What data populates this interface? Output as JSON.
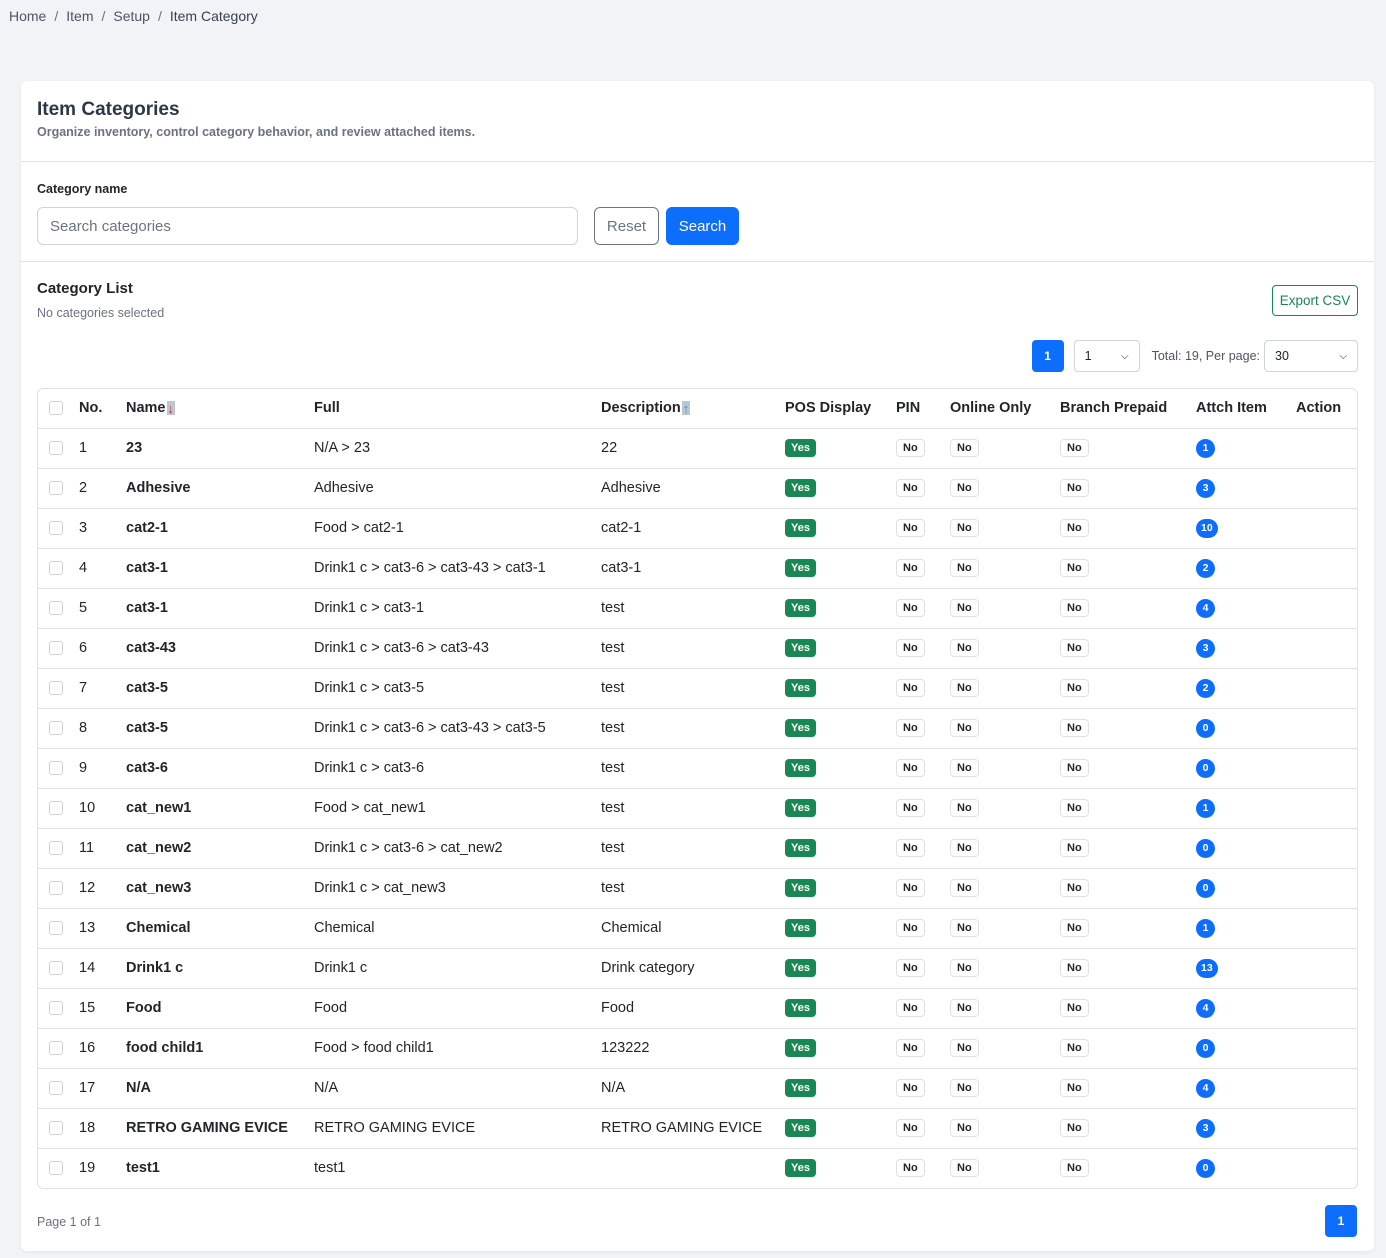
{
  "breadcrumb": [
    "Home",
    "Item",
    "Setup",
    "Item Category"
  ],
  "header": {
    "title": "Item Categories",
    "subtitle": "Organize inventory, control category behavior, and review attached items."
  },
  "filter": {
    "label": "Category name",
    "placeholder": "Search categories",
    "reset_label": "Reset",
    "search_label": "Search"
  },
  "list": {
    "title": "Category List",
    "selection_status": "No categories selected",
    "export_label": "Export CSV",
    "current_page": "1",
    "page_select_value": "1",
    "total_text": "Total: 19, Per page:",
    "per_page_value": "30"
  },
  "table": {
    "columns": [
      "No.",
      "Name",
      "Full",
      "Description",
      "POS Display",
      "PIN",
      "Online Only",
      "Branch Prepaid",
      "Attch Item",
      "Action"
    ],
    "rows": [
      {
        "no": "1",
        "name": "23",
        "full": "N/A > 23",
        "description": "22",
        "pos": "Yes",
        "pin": "No",
        "online": "No",
        "prepaid": "No",
        "items": "1"
      },
      {
        "no": "2",
        "name": "Adhesive",
        "full": "Adhesive",
        "description": "Adhesive",
        "pos": "Yes",
        "pin": "No",
        "online": "No",
        "prepaid": "No",
        "items": "3"
      },
      {
        "no": "3",
        "name": "cat2-1",
        "full": "Food > cat2-1",
        "description": "cat2-1",
        "pos": "Yes",
        "pin": "No",
        "online": "No",
        "prepaid": "No",
        "items": "10"
      },
      {
        "no": "4",
        "name": "cat3-1",
        "full": "Drink1 c > cat3-6 > cat3-43 > cat3-1",
        "description": "cat3-1",
        "pos": "Yes",
        "pin": "No",
        "online": "No",
        "prepaid": "No",
        "items": "2"
      },
      {
        "no": "5",
        "name": "cat3-1",
        "full": "Drink1 c > cat3-1",
        "description": "test",
        "pos": "Yes",
        "pin": "No",
        "online": "No",
        "prepaid": "No",
        "items": "4"
      },
      {
        "no": "6",
        "name": "cat3-43",
        "full": "Drink1 c > cat3-6 > cat3-43",
        "description": "test",
        "pos": "Yes",
        "pin": "No",
        "online": "No",
        "prepaid": "No",
        "items": "3"
      },
      {
        "no": "7",
        "name": "cat3-5",
        "full": "Drink1 c > cat3-5",
        "description": "test",
        "pos": "Yes",
        "pin": "No",
        "online": "No",
        "prepaid": "No",
        "items": "2"
      },
      {
        "no": "8",
        "name": "cat3-5",
        "full": "Drink1 c > cat3-6 > cat3-43 > cat3-5",
        "description": "test",
        "pos": "Yes",
        "pin": "No",
        "online": "No",
        "prepaid": "No",
        "items": "0"
      },
      {
        "no": "9",
        "name": "cat3-6",
        "full": "Drink1 c > cat3-6",
        "description": "test",
        "pos": "Yes",
        "pin": "No",
        "online": "No",
        "prepaid": "No",
        "items": "0"
      },
      {
        "no": "10",
        "name": "cat_new1",
        "full": "Food > cat_new1",
        "description": "test",
        "pos": "Yes",
        "pin": "No",
        "online": "No",
        "prepaid": "No",
        "items": "1"
      },
      {
        "no": "11",
        "name": "cat_new2",
        "full": "Drink1 c > cat3-6 > cat_new2",
        "description": "test",
        "pos": "Yes",
        "pin": "No",
        "online": "No",
        "prepaid": "No",
        "items": "0"
      },
      {
        "no": "12",
        "name": "cat_new3",
        "full": "Drink1 c > cat_new3",
        "description": "test",
        "pos": "Yes",
        "pin": "No",
        "online": "No",
        "prepaid": "No",
        "items": "0"
      },
      {
        "no": "13",
        "name": "Chemical",
        "full": "Chemical",
        "description": "Chemical",
        "pos": "Yes",
        "pin": "No",
        "online": "No",
        "prepaid": "No",
        "items": "1"
      },
      {
        "no": "14",
        "name": "Drink1 c",
        "full": "Drink1 c",
        "description": "Drink category",
        "pos": "Yes",
        "pin": "No",
        "online": "No",
        "prepaid": "No",
        "items": "13"
      },
      {
        "no": "15",
        "name": "Food",
        "full": "Food",
        "description": "Food",
        "pos": "Yes",
        "pin": "No",
        "online": "No",
        "prepaid": "No",
        "items": "4"
      },
      {
        "no": "16",
        "name": "food child1",
        "full": "Food > food child1",
        "description": "123222",
        "pos": "Yes",
        "pin": "No",
        "online": "No",
        "prepaid": "No",
        "items": "0"
      },
      {
        "no": "17",
        "name": "N/A",
        "full": "N/A",
        "description": "N/A",
        "pos": "Yes",
        "pin": "No",
        "online": "No",
        "prepaid": "No",
        "items": "4"
      },
      {
        "no": "18",
        "name": "RETRO GAMING EVICE",
        "full": "RETRO GAMING EVICE",
        "description": "RETRO GAMING EVICE",
        "pos": "Yes",
        "pin": "No",
        "online": "No",
        "prepaid": "No",
        "items": "3"
      },
      {
        "no": "19",
        "name": "test1",
        "full": "test1",
        "description": "",
        "pos": "Yes",
        "pin": "No",
        "online": "No",
        "prepaid": "No",
        "items": "0"
      }
    ]
  },
  "footer": {
    "page_info": "Page 1 of 1",
    "current_page": "1"
  },
  "colors": {
    "primary": "#0d6efd",
    "success": "#198754",
    "background": "#f1f3f7"
  }
}
